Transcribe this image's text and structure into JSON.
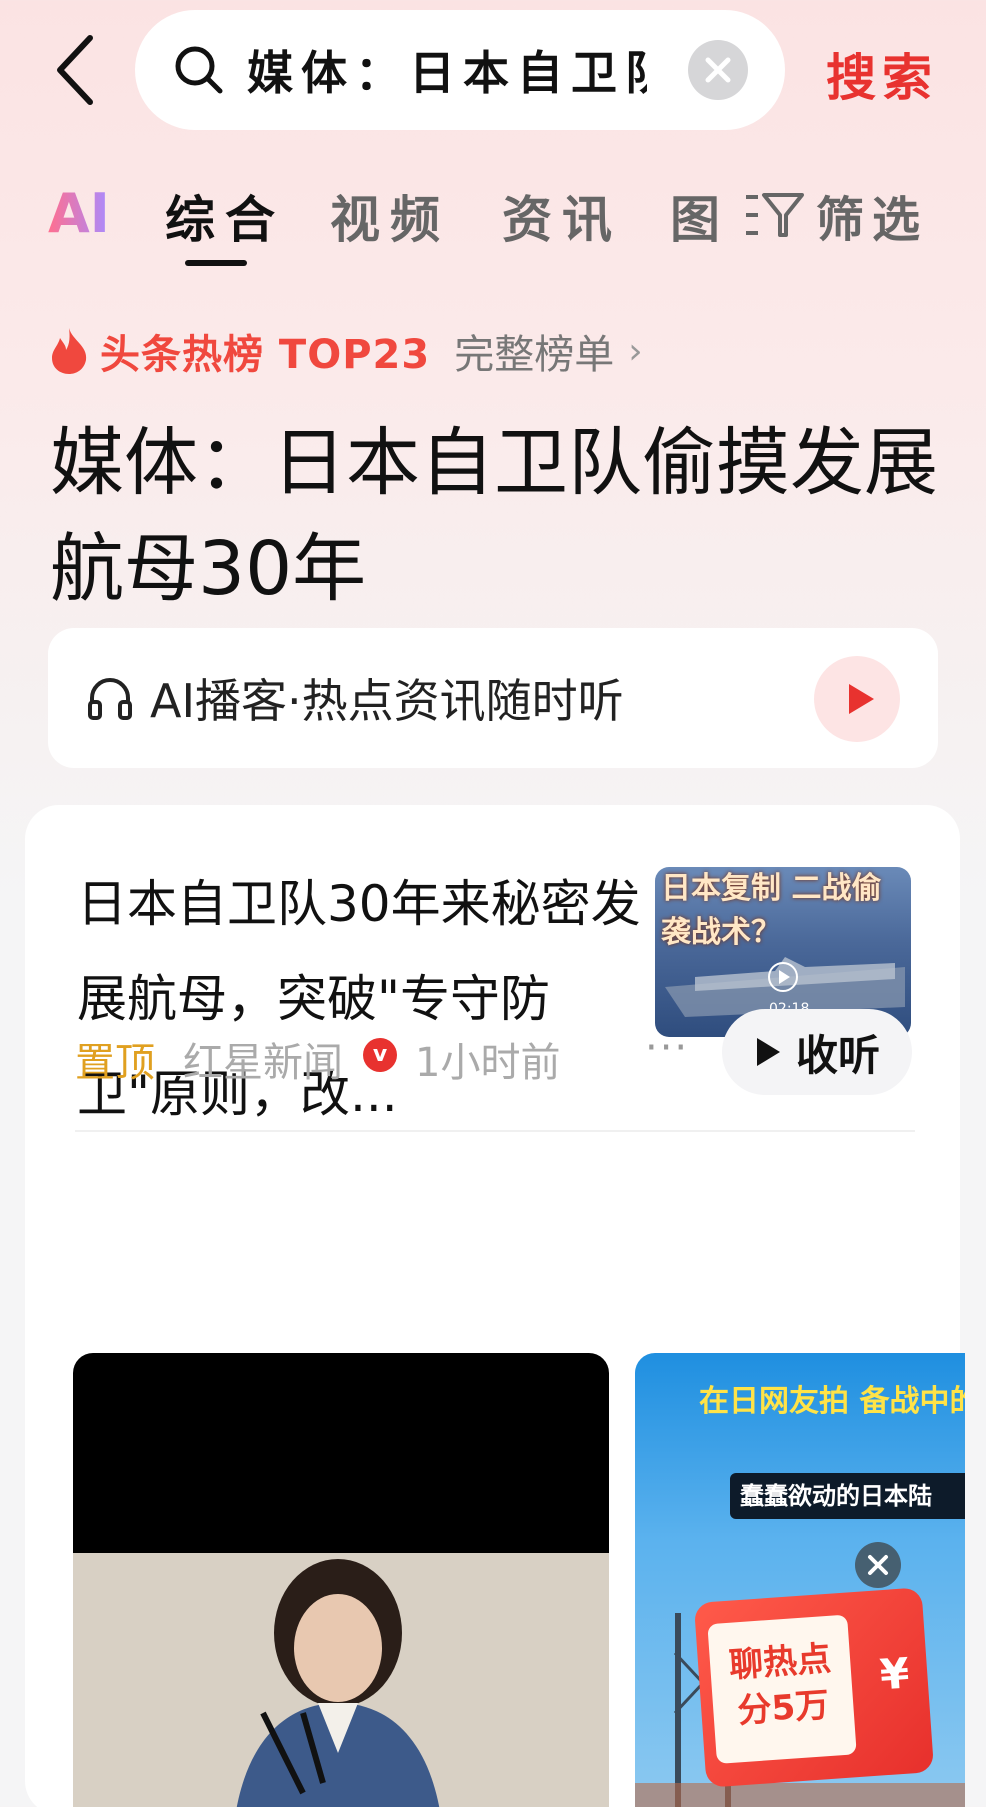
{
  "search": {
    "query": "媒体：日本自卫队",
    "submit_label": "搜索"
  },
  "tabs": {
    "ai": "AI",
    "items": [
      "综合",
      "视频",
      "资讯",
      "图"
    ],
    "active": "综合",
    "filter_label": "筛选"
  },
  "hot": {
    "label": "头条热榜 TOP23",
    "full_list": "完整榜单"
  },
  "headline": "媒体：日本自卫队偷摸发展航母30年",
  "podcast": {
    "label": "AI播客·热点资讯随时听"
  },
  "article": {
    "title": "日本自卫队30年来秘密发展航母，突破\"专守防卫\"原则，改...",
    "thumb_title": "日本复制 二战偷袭战术？",
    "thumb_duration": "02:18",
    "pin": "置顶",
    "source": "红星新闻",
    "verified": "v",
    "time": "1小时前",
    "more": "···",
    "listen_label": "收听"
  },
  "videos": {
    "right_title": "在日网友拍 备战中的日本自卫",
    "right_subtitle": "蠢蠢欲动的日本陆",
    "ad_text": "聊热点 分5万",
    "ad_currency": "¥"
  },
  "colors": {
    "accent": "#e8322f",
    "pin": "#e0a020"
  }
}
